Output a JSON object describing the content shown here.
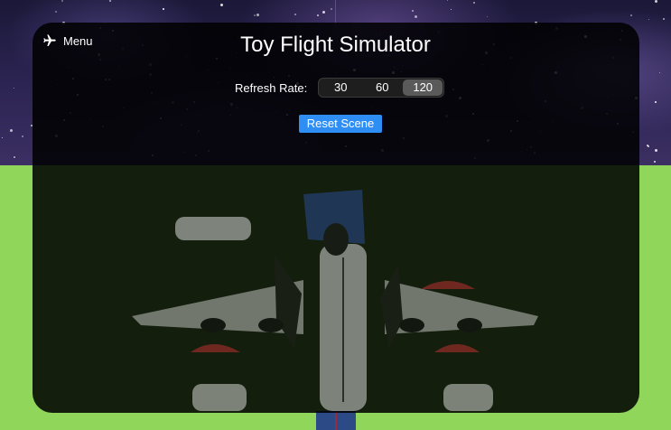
{
  "app": {
    "title": "Toy Flight Simulator"
  },
  "menu": {
    "label": "Menu",
    "icon": "airplane-icon"
  },
  "refresh": {
    "label": "Refresh Rate:",
    "options": [
      "30",
      "60",
      "120"
    ],
    "selected": "120"
  },
  "reset": {
    "label": "Reset Scene",
    "color": "#2f8ef4"
  },
  "colors": {
    "panel": "#000000",
    "ground": "#8fd65a",
    "sky": "#2a2350"
  }
}
